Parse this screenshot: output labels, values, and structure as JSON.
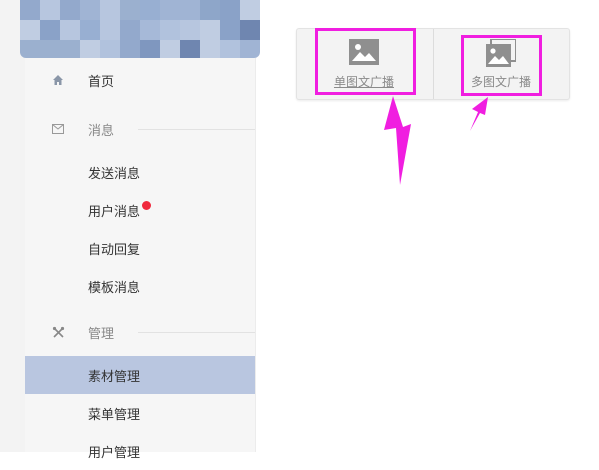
{
  "sidebar": {
    "home": {
      "label": "首页",
      "icon": "home-icon"
    },
    "message_section": {
      "label": "消息",
      "icon": "envelope-icon"
    },
    "message_items": [
      {
        "label": "发送消息"
      },
      {
        "label": "用户消息",
        "has_unread_dot": true
      },
      {
        "label": "自动回复"
      },
      {
        "label": "模板消息"
      }
    ],
    "manage_section": {
      "label": "管理",
      "icon": "tools-icon"
    },
    "manage_items": [
      {
        "label": "素材管理",
        "active": true
      },
      {
        "label": "菜单管理"
      },
      {
        "label": "用户管理"
      }
    ]
  },
  "toolbar": {
    "single_label": "单图文广播",
    "multi_label": "多图文广播"
  },
  "colors": {
    "highlight": "#f01ee0",
    "active_item_bg": "#b9c6e0",
    "unread_dot": "#f0293d"
  }
}
